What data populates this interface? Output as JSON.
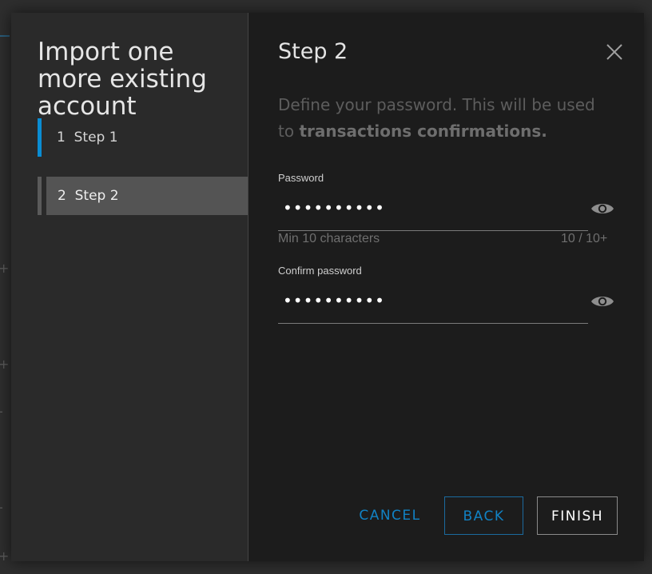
{
  "wizard": {
    "title": "Import one more existing account",
    "steps": [
      {
        "label": "1  Step 1"
      },
      {
        "label": "2  Step 2"
      }
    ]
  },
  "step": {
    "title": "Step 2",
    "description_prefix": "Define your password. This will be used to ",
    "description_bold": "transactions confirmations."
  },
  "password": {
    "label": "Password",
    "value": "••••••••••",
    "hint": "Min 10 characters",
    "counter": "10 / 10+"
  },
  "confirm": {
    "label": "Confirm password",
    "value": "••••••••••"
  },
  "buttons": {
    "cancel": "CANCEL",
    "back": "BACK",
    "finish": "FINISH"
  },
  "icons": {
    "close": "close-icon",
    "visibility": "eye-icon"
  },
  "colors": {
    "accent": "#0a8dd3",
    "link": "#1182c4",
    "modal_bg": "#1c1c1c",
    "sidebar_bg": "#2a2a2a"
  }
}
